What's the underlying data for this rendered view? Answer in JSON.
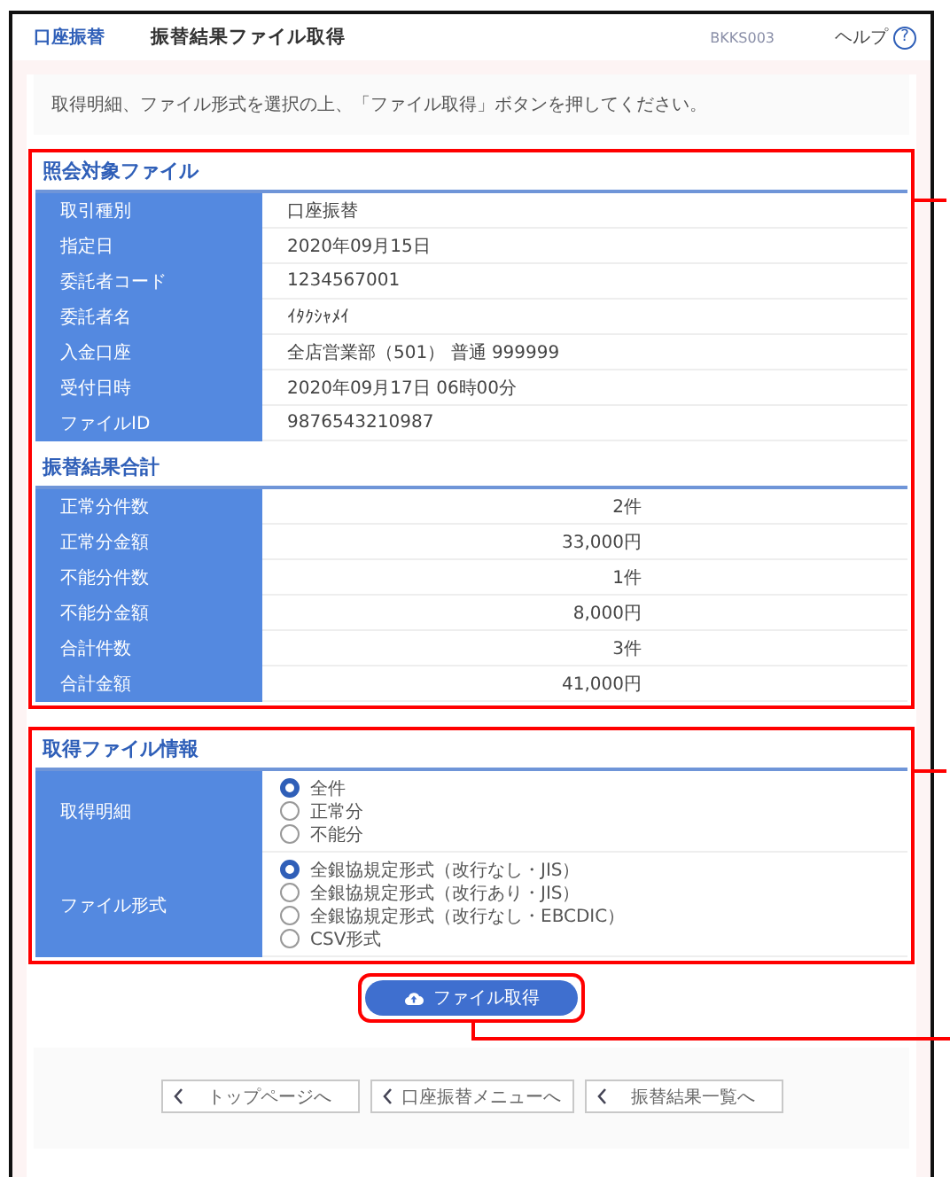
{
  "header": {
    "breadcrumb": "口座振替",
    "title": "振替結果ファイル取得",
    "screen_id": "BKKS003",
    "help": "ヘルプ",
    "help_mark": "?"
  },
  "instruction": "取得明細、ファイル形式を選択の上、「ファイル取得」ボタンを押してください。",
  "target_file": {
    "title": "照会対象ファイル",
    "rows": [
      {
        "label": "取引種別",
        "value": "口座振替"
      },
      {
        "label": "指定日",
        "value": "2020年09月15日"
      },
      {
        "label": "委託者コード",
        "value": "1234567001"
      },
      {
        "label": "委託者名",
        "value": "ｲﾀｸｼｬﾒｲ"
      },
      {
        "label": "入金口座",
        "value": "全店営業部（501） 普通 999999"
      },
      {
        "label": "受付日時",
        "value": "2020年09月17日 06時00分"
      },
      {
        "label": "ファイルID",
        "value": "9876543210987"
      }
    ]
  },
  "totals": {
    "title": "振替結果合計",
    "rows": [
      {
        "label": "正常分件数",
        "value": "2件"
      },
      {
        "label": "正常分金額",
        "value": "33,000円"
      },
      {
        "label": "不能分件数",
        "value": "1件"
      },
      {
        "label": "不能分金額",
        "value": "8,000円"
      },
      {
        "label": "合計件数",
        "value": "3件"
      },
      {
        "label": "合計金額",
        "value": "41,000円"
      }
    ]
  },
  "file_options": {
    "title": "取得ファイル情報",
    "groups": [
      {
        "label": "取得明細",
        "options": [
          {
            "label": "全件",
            "selected": true
          },
          {
            "label": "正常分",
            "selected": false
          },
          {
            "label": "不能分",
            "selected": false
          }
        ]
      },
      {
        "label": "ファイル形式",
        "options": [
          {
            "label": "全銀協規定形式（改行なし・JIS）",
            "selected": true
          },
          {
            "label": "全銀協規定形式（改行あり・JIS）",
            "selected": false
          },
          {
            "label": "全銀協規定形式（改行なし・EBCDIC）",
            "selected": false
          },
          {
            "label": "CSV形式",
            "selected": false
          }
        ]
      }
    ]
  },
  "download_button": {
    "label": "ファイル取得"
  },
  "nav_buttons": [
    {
      "label": "トップページへ"
    },
    {
      "label": "口座振替メニューへ"
    },
    {
      "label": "振替結果一覧へ"
    }
  ]
}
